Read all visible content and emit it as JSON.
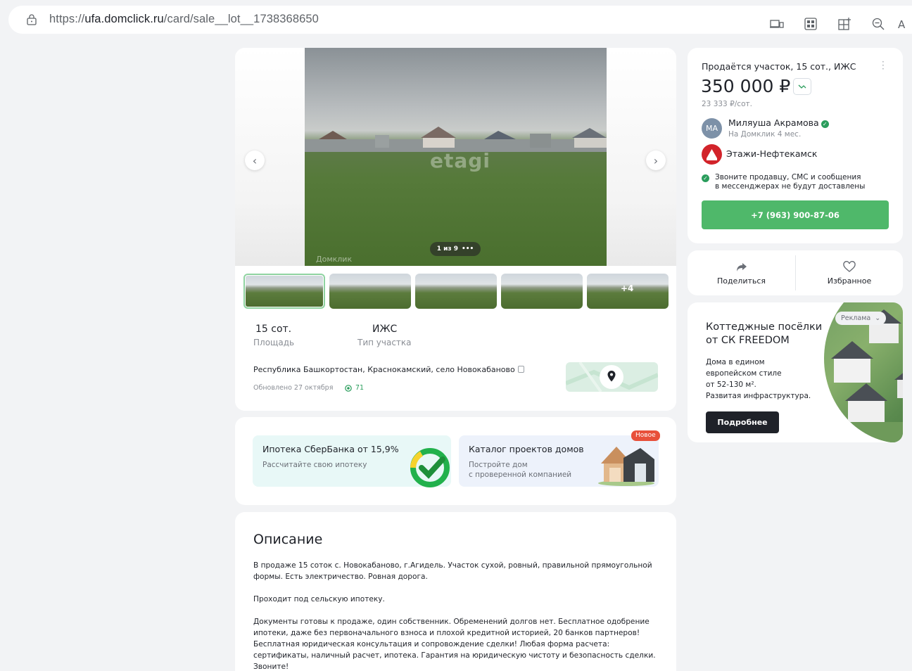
{
  "browser": {
    "url_prefix": "https://",
    "url_domain": "ufa.domclick.ru",
    "url_path": "/card/sale__lot__1738368650"
  },
  "gallery": {
    "watermark": "etagi",
    "counter": "1 из 9",
    "counter_dots": "•••",
    "photo_mark": "Домклик",
    "thumbs_more": "+4",
    "prev_arrow": "‹",
    "next_arrow": "›"
  },
  "facts": [
    {
      "value": "15 сот.",
      "label": "Площадь"
    },
    {
      "value": "ИЖС",
      "label": "Тип участка"
    }
  ],
  "location": {
    "address": "Республика Башкортостан, Краснокамский, село Новокабаново",
    "updated": "Обновлено 27 октября",
    "views": "71"
  },
  "promo": {
    "sber_title": "Ипотека СберБанка от 15,9%",
    "sber_sub": "Рассчитайте свою ипотеку",
    "catalog_title": "Каталог проектов домов",
    "catalog_sub_1": "Постройте дом",
    "catalog_sub_2": "с проверенной компанией",
    "badge": "Новое"
  },
  "description": {
    "title": "Описание",
    "p1": "В продаже 15 соток с. Новокабаново, г.Агидель. Участок сухой, ровный, правильной прямоугольной формы. Есть электричество. Ровная дорога.",
    "p2": "Проходит под сельскую ипотеку.",
    "p3": "Документы готовы к продаже, один собственник. Обременений долгов нет. Бесплатное одобрение ипотеки, даже без первоначального взноса и плохой кредитной историей, 20 банков партнеров! Бесплатная юридическая консультация и сопровождение сделки! Любая форма расчета: сертификаты, наличный расчет, ипотека. Гарантия на юридическую чистоту и безопасность сделки. Звоните!"
  },
  "seller": {
    "title": "Продаётся участок, 15 сот., ИЖС",
    "price": "350 000 ₽",
    "price_per_unit": "23 333 ₽/сот.",
    "avatar_initials": "МА",
    "agent_name": "Миляуша Акрамова",
    "agent_since": "На Домклик 4 мес.",
    "agency_name": "Этажи-Нефтекамск",
    "notice_1": "Звоните продавцу, СМС и сообщения",
    "notice_2": "в мессенджерах не будут доставлены",
    "phone": "+7 (963) 900-87-06"
  },
  "actions": {
    "share": "Поделиться",
    "favorite": "Избранное"
  },
  "ad": {
    "label": "Реклама",
    "title_1": "Коттеджные посёлки",
    "title_2": "от СК FREEDOM",
    "text_1": "Дома в едином",
    "text_2": "европейском стиле",
    "text_3": "от 52-130 м².",
    "text_4": "Развитая инфраструктура.",
    "button": "Подробнее"
  },
  "colors": {
    "accent_green": "#4fb86a",
    "new_badge": "#e8503a",
    "agency_red": "#d2232a"
  }
}
